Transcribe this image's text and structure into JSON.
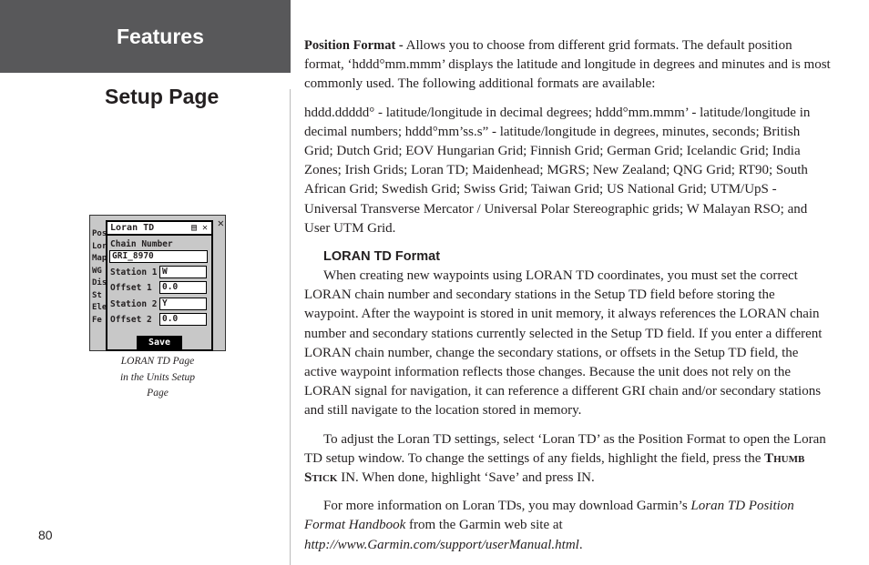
{
  "header": {
    "section": "Features",
    "title": "Setup Page"
  },
  "page_number": "80",
  "figure": {
    "caption": [
      "LORAN TD Page",
      "in the Units Setup",
      "Page"
    ],
    "dialog_title": "Loran TD",
    "chain_number_label": "Chain Number",
    "chain_number_value": "GRI_8970",
    "fields": [
      {
        "label": "Station 1",
        "value": "W"
      },
      {
        "label": "Offset 1",
        "value": "0.0"
      },
      {
        "label": "Station 2",
        "value": "Y"
      },
      {
        "label": "Offset 2",
        "value": "0.0"
      }
    ],
    "save_label": "Save",
    "background_labels": [
      "Pos",
      "Lor",
      "Map",
      "WG",
      "Dis",
      "St",
      "Ele",
      "Fe"
    ]
  },
  "body": {
    "p1_bold": "Position Format -",
    "p1": " Allows you to choose from different grid formats.  The default position format, ‘hddd°mm.mmm’ displays the latitude and longitude in degrees and minutes and is most commonly used.  The following additional formats are available:",
    "p2": "hddd.ddddd° - latitude/longitude in decimal degrees; hddd°mm.mmm’ - latitude/longitude in decimal numbers; hddd°mm’ss.s” - latitude/longitude in degrees, minutes, seconds; British Grid; Dutch Grid; EOV Hungarian Grid; Finnish Grid; German Grid; Icelandic Grid; India Zones; Irish Grids; Loran TD; Maidenhead; MGRS; New Zealand; QNG Grid; RT90; South African Grid; Swedish Grid; Swiss Grid; Taiwan Grid; US National Grid; UTM/UpS - Universal Transverse Mercator / Universal Polar Stereographic grids; W Malayan RSO; and User UTM Grid.",
    "h_loran": "LORAN TD Format",
    "p3": "When creating new waypoints using LORAN TD coordinates, you must set the correct LORAN chain number and secondary stations in the Setup TD field before storing the waypoint.  After the waypoint is stored in unit memory, it always references the LORAN chain number and secondary stations currently selected in the Setup TD field.  If you enter a different LORAN chain number, change the secondary stations, or offsets in the Setup TD field, the active waypoint information reflects those changes.  Because the unit does not rely on the LORAN signal for navigation, it can reference a different GRI chain and/or secondary stations and still navigate to the location stored in memory.",
    "p4a": "To adjust the Loran TD settings, select ‘Loran TD’ as the Position Format to open the Loran TD setup window.  To change the settings of any fields, highlight the field, press the ",
    "p4b": "Thumb Stick",
    "p4c": " IN.  When done, highlight ‘Save’ and press IN.",
    "p5a": "For more information on Loran TDs, you may download Garmin’s ",
    "p5b": "Loran TD Position Format Handbook",
    "p5c": " from the Garmin web site at ",
    "p5d": "http://www.Garmin.com/support/userManual.html",
    "p5e": "."
  }
}
